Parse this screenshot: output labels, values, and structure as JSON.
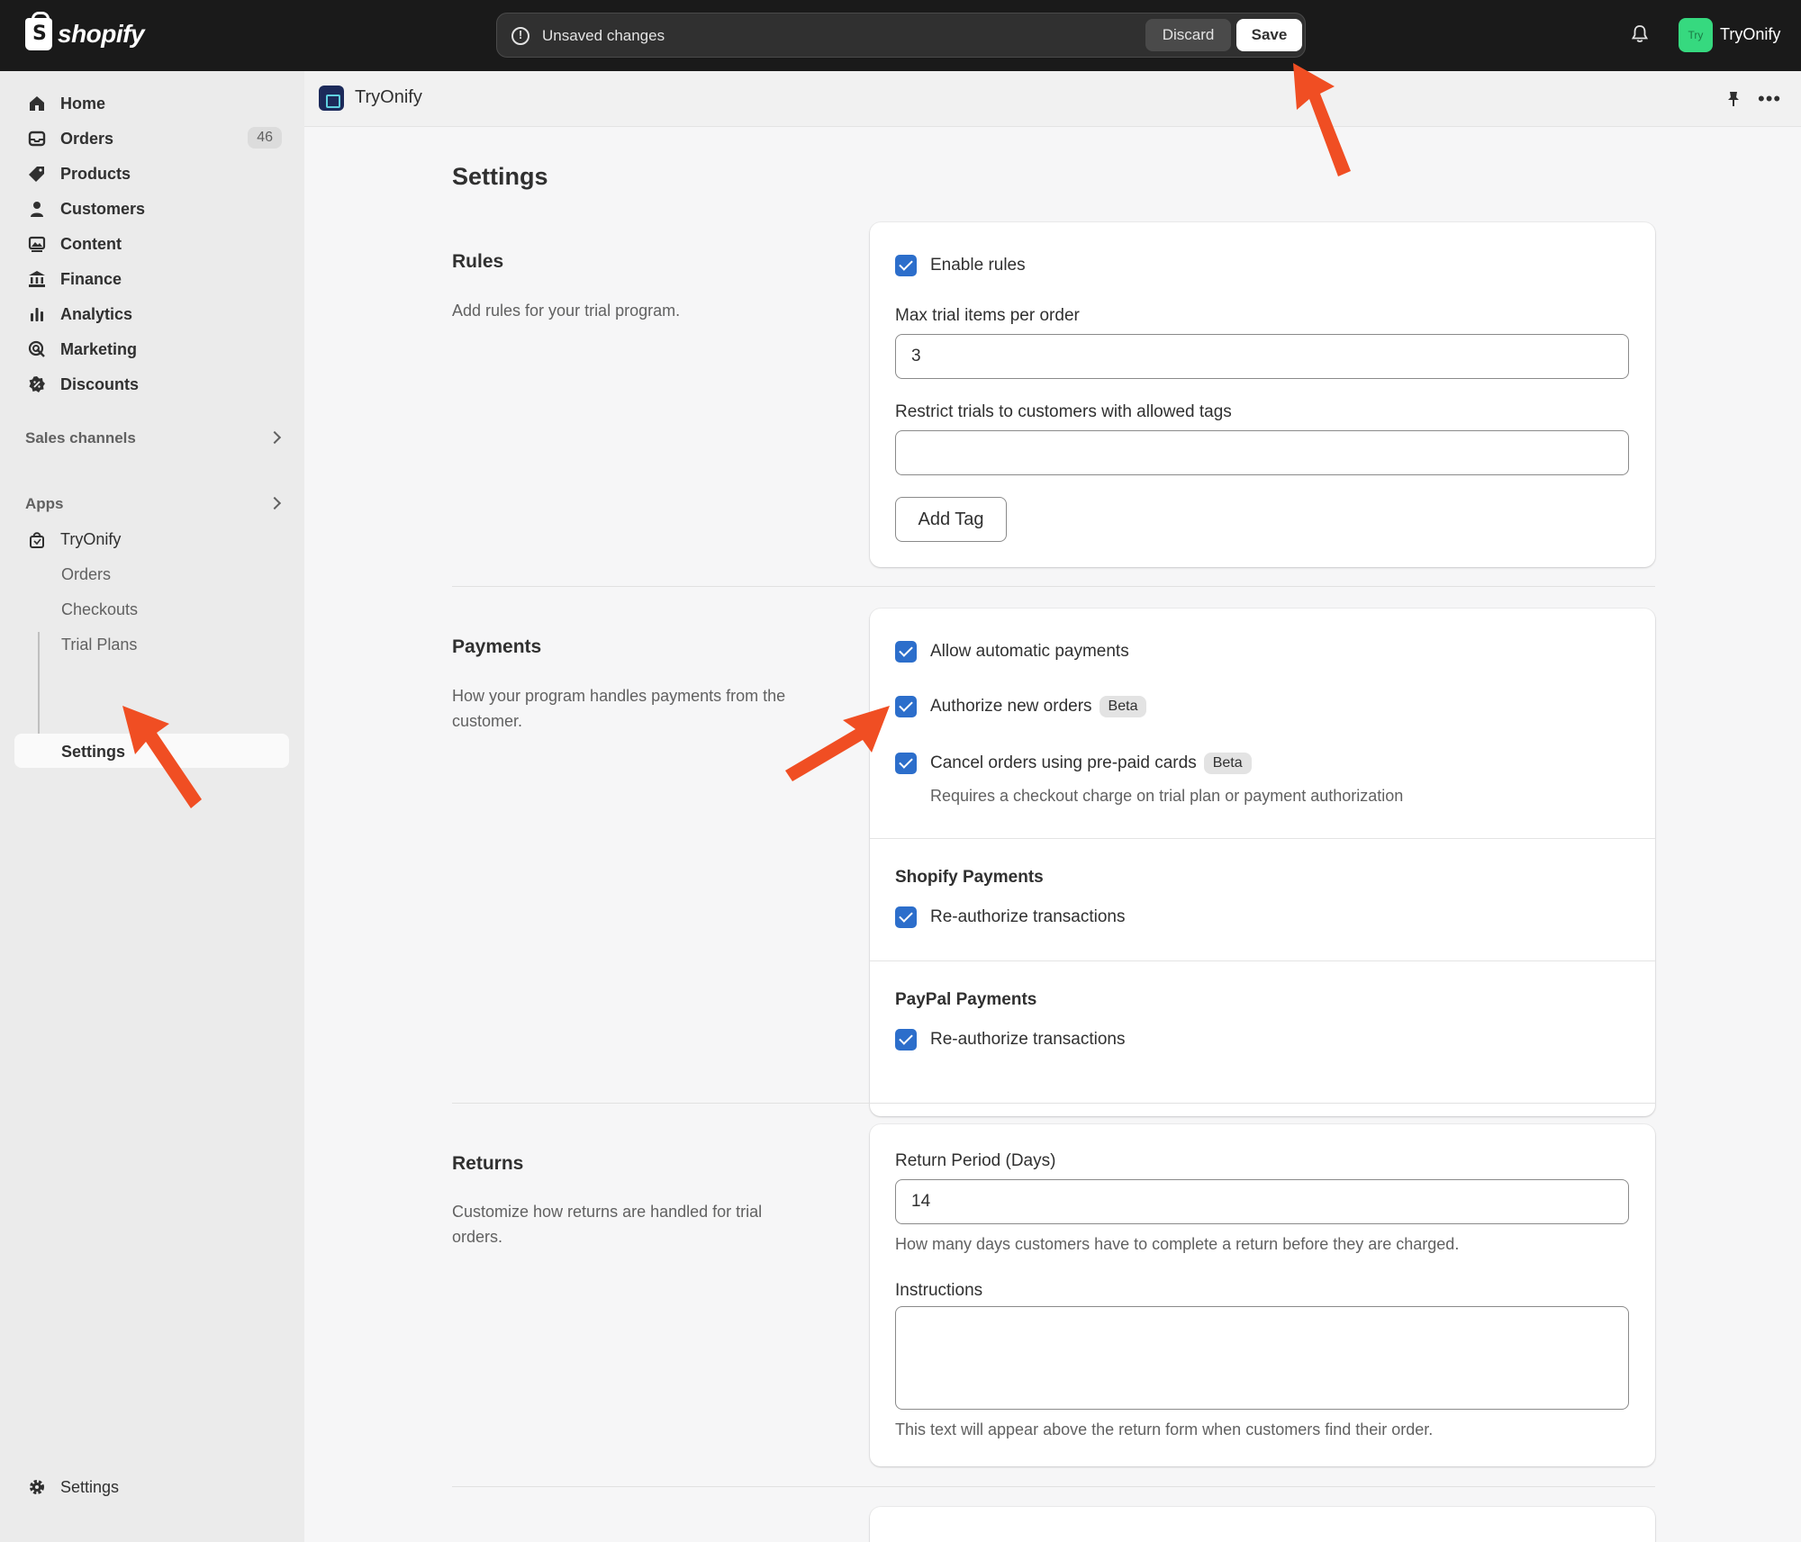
{
  "topbar": {
    "logo_text": "shopify",
    "unsaved_message": "Unsaved changes",
    "discard_label": "Discard",
    "save_label": "Save",
    "store_badge": "Try",
    "store_name": "TryOnify"
  },
  "sidebar": {
    "items": [
      {
        "label": "Home"
      },
      {
        "label": "Orders",
        "count": "46"
      },
      {
        "label": "Products"
      },
      {
        "label": "Customers"
      },
      {
        "label": "Content"
      },
      {
        "label": "Finance"
      },
      {
        "label": "Analytics"
      },
      {
        "label": "Marketing"
      },
      {
        "label": "Discounts"
      }
    ],
    "sales_channels": "Sales channels",
    "apps": "Apps",
    "app_name": "TryOnify",
    "app_sub_items": [
      "Orders",
      "Checkouts",
      "Trial Plans",
      "Settings"
    ],
    "settings": "Settings"
  },
  "app_header": {
    "title": "TryOnify"
  },
  "page": {
    "title": "Settings",
    "rules": {
      "title": "Rules",
      "description": "Add rules for your trial program.",
      "enable_rules": "Enable rules",
      "max_items_label": "Max trial items per order",
      "max_items_value": "3",
      "restrict_label": "Restrict trials to customers with allowed tags",
      "restrict_value": "",
      "add_tag": "Add Tag"
    },
    "payments": {
      "title": "Payments",
      "description": "How your program handles payments from the customer.",
      "allow_auto": "Allow automatic payments",
      "authorize_new": "Authorize new orders",
      "cancel_prepaid": "Cancel orders using pre-paid cards",
      "beta": "Beta",
      "cancel_help": "Requires a checkout charge on trial plan or payment authorization",
      "shopify_title": "Shopify Payments",
      "shopify_reauth": "Re-authorize transactions",
      "paypal_title": "PayPal Payments",
      "paypal_reauth": "Re-authorize transactions"
    },
    "returns": {
      "title": "Returns",
      "description": "Customize how returns are handled for trial orders.",
      "period_label": "Return Period (Days)",
      "period_value": "14",
      "period_help": "How many days customers have to complete a return before they are charged.",
      "instructions_label": "Instructions",
      "instructions_help": "This text will appear above the return form when customers find their order."
    }
  },
  "colors": {
    "checkbox": "#2c6ecb",
    "arrow": "#f04e23",
    "topbar": "#1a1a1a"
  }
}
